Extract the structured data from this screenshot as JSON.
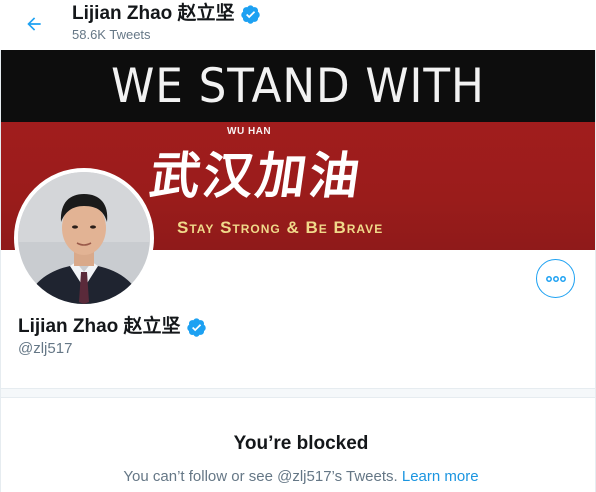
{
  "header": {
    "name": "Lijian Zhao 赵立坚",
    "tweet_count": "58.6K Tweets",
    "back_icon": "arrow-left-icon"
  },
  "banner": {
    "headline": "WE STAND WITH",
    "city_label": "WU HAN",
    "chinese_text": "武汉加油",
    "slogan": "Stay Strong & Be Brave"
  },
  "profile": {
    "name": "Lijian Zhao 赵立坚",
    "handle": "@zlj517",
    "verified_icon": "verified-badge-icon",
    "more_icon": "more-options-icon"
  },
  "blocked": {
    "title": "You’re blocked",
    "message": "You can’t follow or see @zlj517’s Tweets.",
    "link_label": "Learn more"
  },
  "colors": {
    "accent": "#1da1f2",
    "link": "#1b95e0",
    "muted": "#657786",
    "banner_red": "#9a1c1b",
    "banner_black": "#0d0d0d",
    "slogan_gold": "#f0d98a"
  }
}
